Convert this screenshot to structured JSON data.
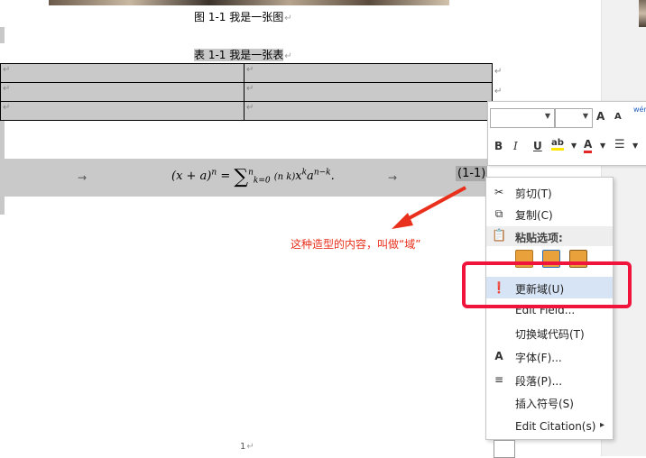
{
  "document": {
    "figure_caption": "图 1-1 我是一张图",
    "table_caption": "表 1-1 我是一张表",
    "para_mark": "↵",
    "tab_arrow": "→",
    "equation": {
      "lhs": "(x + a)",
      "lhs_power": "n",
      "eq_sign": " = ",
      "sigma": "∑",
      "sigma_upper": "n",
      "sigma_lower": "k=0",
      "binomial": "(n k)",
      "term": "x",
      "term_power": "k",
      "term2": "a",
      "term2_power": "n−k",
      "end_mark": "."
    },
    "field_number": "(1-1)",
    "page_number": "1",
    "annotation": "这种造型的内容，叫做“域”"
  },
  "mini_toolbar": {
    "font_name_value": "",
    "font_size_value": "",
    "grow_font": "A",
    "shrink_font": "A",
    "phonetic": "wén",
    "bold": "B",
    "italic": "I",
    "underline": "U",
    "highlight": "ab",
    "font_color": "A"
  },
  "context_menu": {
    "items": [
      {
        "label": "剪切(T)",
        "icon": "scissors-icon"
      },
      {
        "label": "复制(C)",
        "icon": "copy-icon"
      },
      {
        "label": "粘贴选项:",
        "icon": "paste-icon"
      },
      {
        "label": "更新域(U)",
        "icon": "update-field-icon"
      },
      {
        "label": "Edit Field...",
        "icon": ""
      },
      {
        "label": "切换域代码(T)",
        "icon": ""
      },
      {
        "label": "字体(F)...",
        "icon": "font-icon"
      },
      {
        "label": "段落(P)...",
        "icon": "paragraph-icon"
      },
      {
        "label": "插入符号(S)",
        "icon": ""
      },
      {
        "label": "Edit Citation(s)",
        "icon": ""
      }
    ],
    "submenu_arrow": "▸"
  },
  "colors": {
    "highlight": "#c9c9c9",
    "annotation_red": "#e8301c",
    "redbox": "#f0143c",
    "menu_hover": "#d7e4f5"
  }
}
